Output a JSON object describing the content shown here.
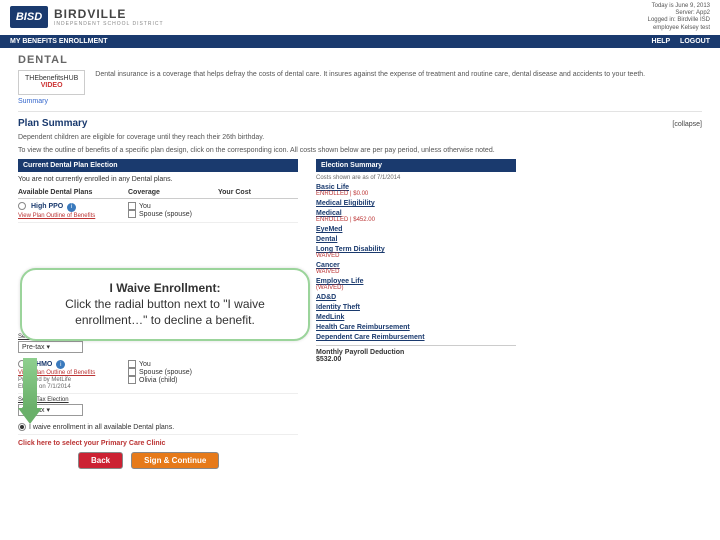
{
  "header": {
    "logo_badge": "BISD",
    "logo_text": "BIRDVILLE",
    "logo_sub": "INDEPENDENT SCHOOL DISTRICT",
    "meta_date": "Today is June 9, 2013",
    "meta_server": "Server: App2",
    "meta_logged": "Logged in: Birdville ISD",
    "meta_emp": "employee Kelsey test"
  },
  "nav": {
    "left": "MY BENEFITS ENROLLMENT",
    "help": "HELP",
    "logout": "LOGOUT"
  },
  "page": {
    "title": "DENTAL",
    "hub_line1": "THEbenefitsHUB",
    "hub_line2": "VIDEO",
    "summary_link": "Summary",
    "intro": "Dental insurance is a coverage that helps defray the costs of dental care. It insures against the expense of treatment and routine care, dental disease and accidents to your teeth.",
    "plan_summary": "Plan Summary",
    "collapse": "[collapse]",
    "note1": "Dependent children are eligible for coverage until they reach their 26th birthday.",
    "note2": "To view the outline of benefits of a specific plan design, click on the corresponding icon. All costs shown below are per pay period, unless otherwise noted."
  },
  "left": {
    "bar": "Current Dental Plan Election",
    "not_enrolled": "You are not currently enrolled in any Dental plans.",
    "th1": "Available Dental Plans",
    "th2": "Coverage",
    "th3": "Your Cost",
    "plan1": {
      "name": "High PPO",
      "view": "View Plan Outline of Benefits",
      "cov1": "You",
      "cov2": "Spouse (spouse)"
    },
    "plan2": {
      "name": "DHMO",
      "view": "View Plan Outline of Benefits",
      "prov": "Provided by MetLife",
      "elig": "Eligible on 7/1/2014",
      "cov1": "You",
      "cov2": "Spouse (spouse)",
      "cov3": "Olivia (child)"
    },
    "tax_label": "Select Tax Election",
    "tax_value": "Pre-tax ▾",
    "waive": "I waive enrollment in all available Dental plans.",
    "primary": "Click here to select your Primary Care Clinic"
  },
  "right": {
    "bar": "Election Summary",
    "asof": "Costs shown are as of 7/1/2014",
    "items": [
      {
        "h": "Basic Life",
        "s": "ENROLLED | $0.00"
      },
      {
        "h": "Medical Eligibility",
        "s": ""
      },
      {
        "h": "Medical",
        "s": "ENROLLED | $452.00"
      },
      {
        "h": "EyeMed",
        "s": ""
      },
      {
        "h": "Dental",
        "s": ""
      },
      {
        "h": "Long Term Disability",
        "s": "WAIVED"
      },
      {
        "h": "Cancer",
        "s": "WAIVED"
      },
      {
        "h": "Employee Life",
        "s": "(WAIVED)"
      },
      {
        "h": "AD&D",
        "s": ""
      },
      {
        "h": "Identity Theft",
        "s": ""
      },
      {
        "h": "MedLink",
        "s": ""
      },
      {
        "h": "Health Care Reimbursement",
        "s": ""
      },
      {
        "h": "Dependent Care Reimbursement",
        "s": ""
      }
    ],
    "deduct_label": "Monthly Payroll Deduction",
    "deduct_value": "$532.00"
  },
  "buttons": {
    "back": "Back",
    "sign": "Sign & Continue"
  },
  "callout": {
    "title": "I Waive Enrollment:",
    "body1": "Click the radial button next to \"I waive",
    "body2": "enrollment…\" to decline a benefit."
  }
}
